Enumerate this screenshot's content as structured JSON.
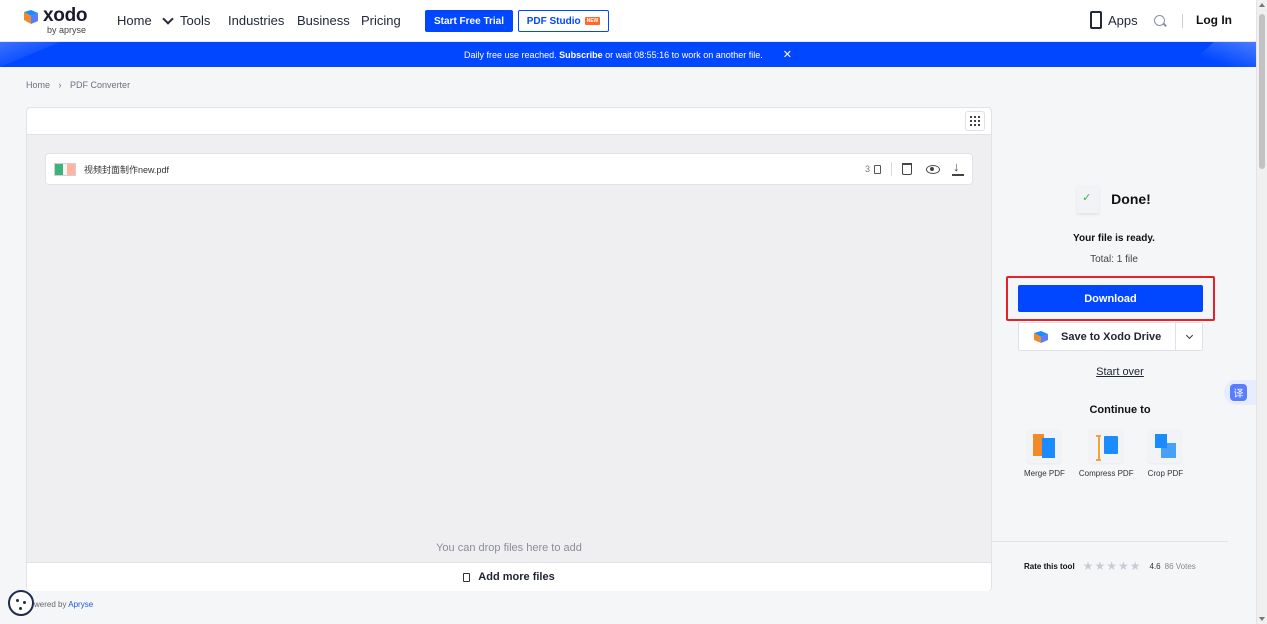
{
  "brand": {
    "name": "xodo",
    "sub": "by apryse"
  },
  "nav": {
    "home": "Home",
    "tools": "Tools",
    "industries": "Industries",
    "business": "Business",
    "pricing": "Pricing",
    "start_trial": "Start Free Trial",
    "pdf_studio": "PDF Studio",
    "new_badge": "NEW",
    "apps": "Apps",
    "login": "Log In"
  },
  "banner": {
    "prefix": "Daily free use reached.",
    "subscribe": "Subscribe",
    "suffix": "or wait 08:55:16 to work on another file.",
    "close": "✕"
  },
  "breadcrumb": {
    "home": "Home",
    "sep": "›",
    "current": "PDF Converter"
  },
  "file": {
    "name": "视频封面制作new.pdf",
    "pages": "3"
  },
  "drop_text": "You can drop files here to add",
  "add_more": "Add more files",
  "result": {
    "done": "Done!",
    "ready": "Your file is ready.",
    "total": "Total: 1 file",
    "download": "Download",
    "save_drive": "Save to Xodo Drive",
    "start_over": "Start over",
    "continue_to": "Continue to"
  },
  "tools": [
    {
      "label": "Merge PDF"
    },
    {
      "label": "Compress PDF"
    },
    {
      "label": "Crop PDF"
    }
  ],
  "rating": {
    "label": "Rate this tool",
    "score": "4.6",
    "votes": "86 Votes",
    "stars": 5
  },
  "footer": {
    "powered_prefix": "wered by",
    "powered_link": "Apryse"
  },
  "translate_glyph": "译",
  "colors": {
    "accent": "#0047ff",
    "highlight": "#e8202a"
  }
}
